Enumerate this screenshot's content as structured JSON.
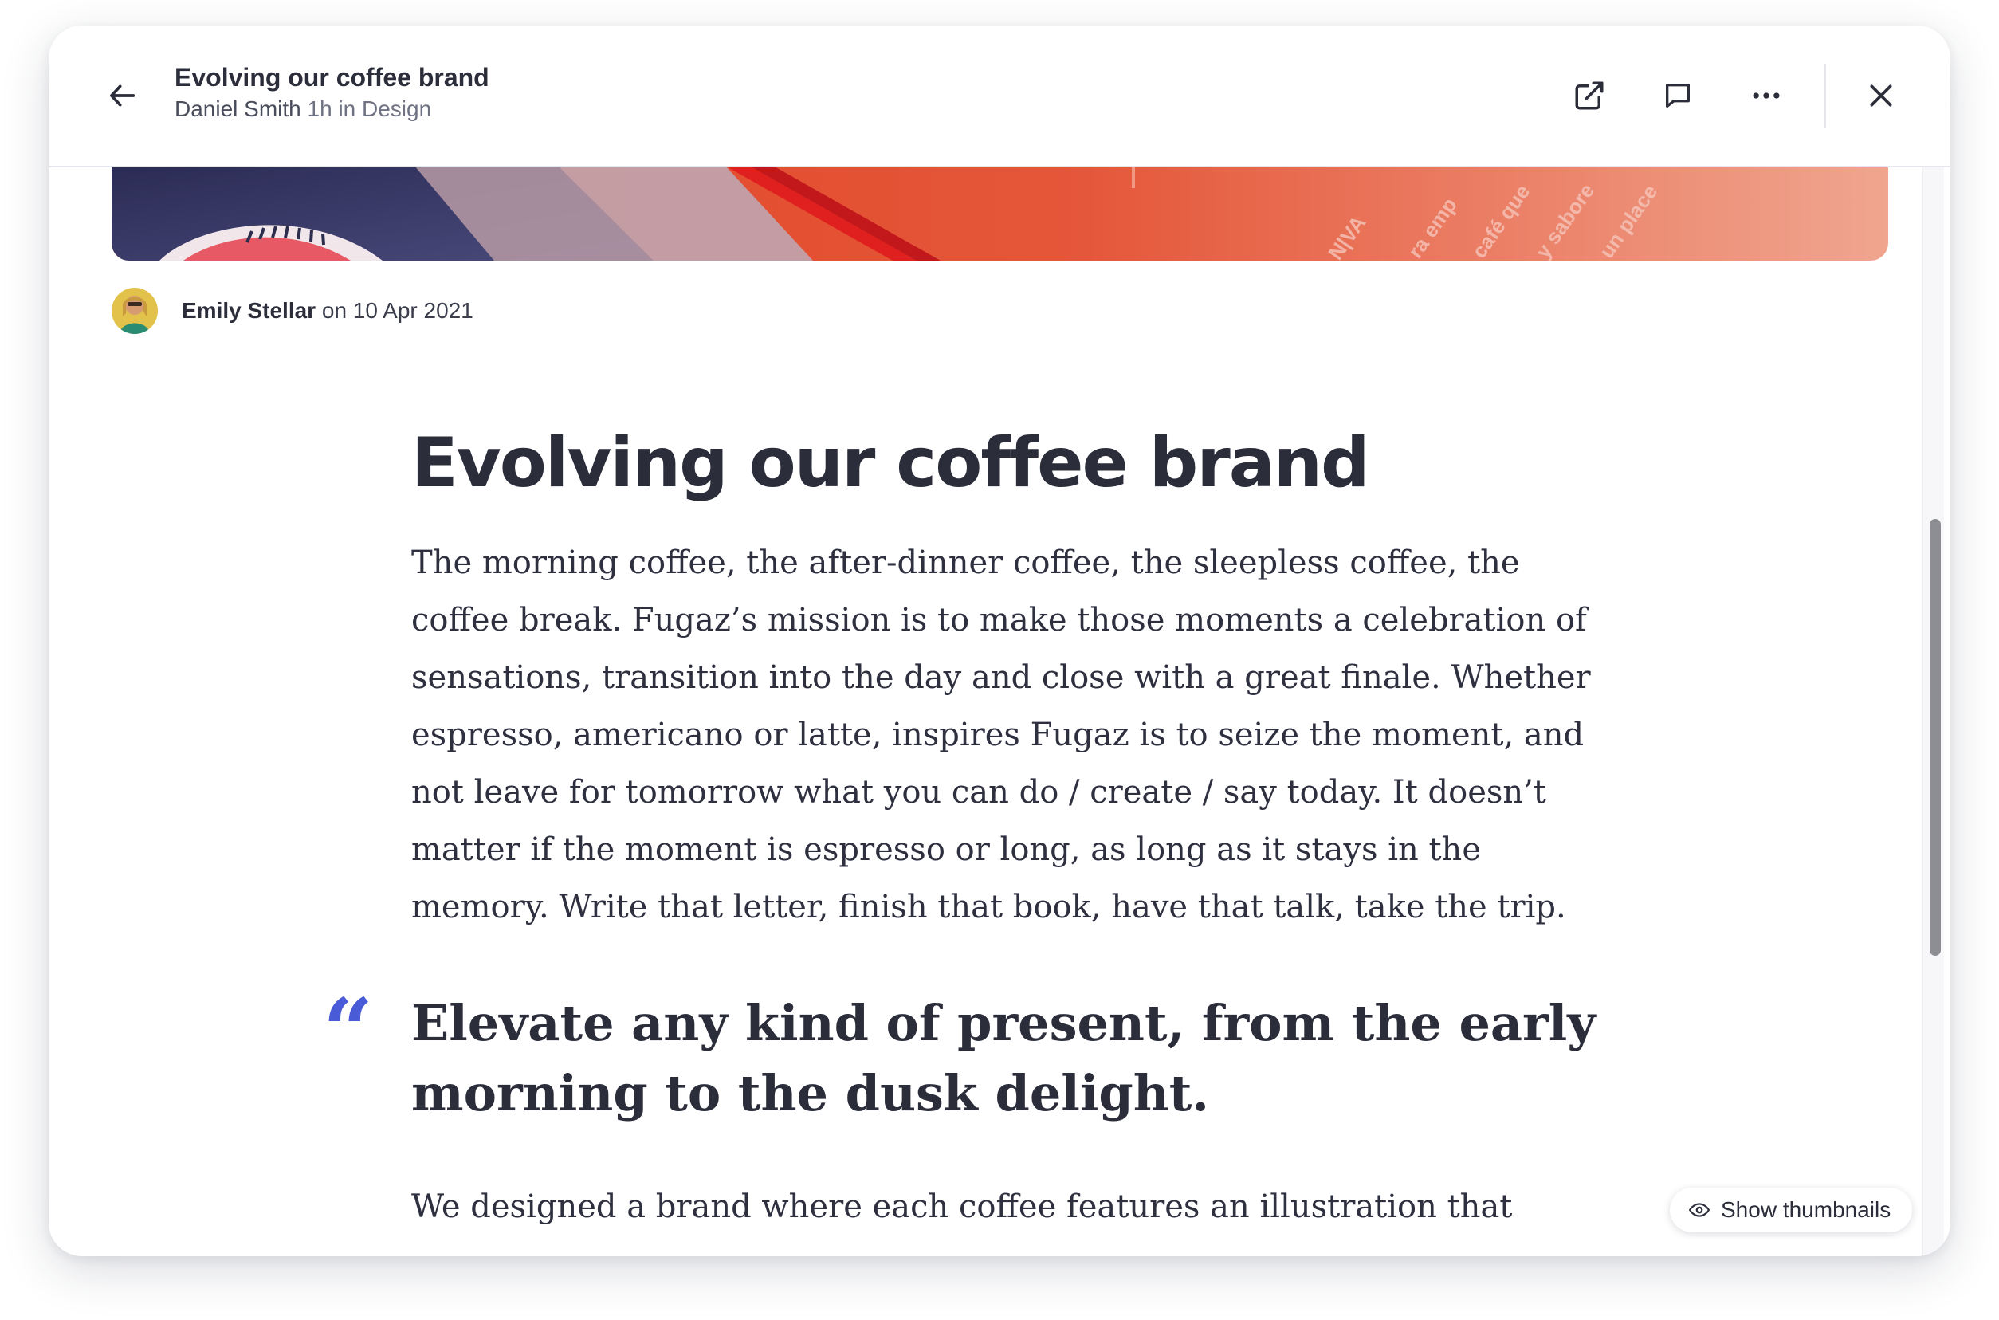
{
  "header": {
    "title": "Evolving our coffee brand",
    "author": "Daniel Smith",
    "meta_suffix": "1h in Design",
    "back_icon": "arrow-left-icon",
    "actions": [
      {
        "name": "open-external",
        "icon": "external-link-icon"
      },
      {
        "name": "comment",
        "icon": "comment-icon"
      },
      {
        "name": "more",
        "icon": "more-horizontal-icon"
      },
      {
        "name": "close",
        "icon": "close-icon"
      }
    ]
  },
  "byline": {
    "author": "Emily Stellar",
    "date_text": "on 10 Apr 2021"
  },
  "article": {
    "title": "Evolving our coffee brand",
    "paragraph_1": "The morning coffee, the after-dinner coffee, the sleepless coffee, the coffee break. Fugaz’s mission is to make those moments a celebration of sensations, transition into the day and close with a great finale. Whether espresso, americano or latte, inspires Fugaz is to seize the moment, and not leave for tomorrow what you can do / create / say today. It doesn’t matter if the moment is espresso or long, as long as it stays in the memory. Write that letter, finish that book, have that talk, take the trip.",
    "quote_mark": "“",
    "quote": "Elevate any kind of present, from the early morning to the dusk delight.",
    "paragraph_2": "We designed a brand where each coffee features an illustration that"
  },
  "thumbnails_button": {
    "label": "Show thumbnails",
    "icon": "eye-icon"
  },
  "colors": {
    "accent": "#4a5bd8",
    "text": "#2b2d3a",
    "muted": "#6f7283",
    "scrollbar": "#8d8e94"
  }
}
